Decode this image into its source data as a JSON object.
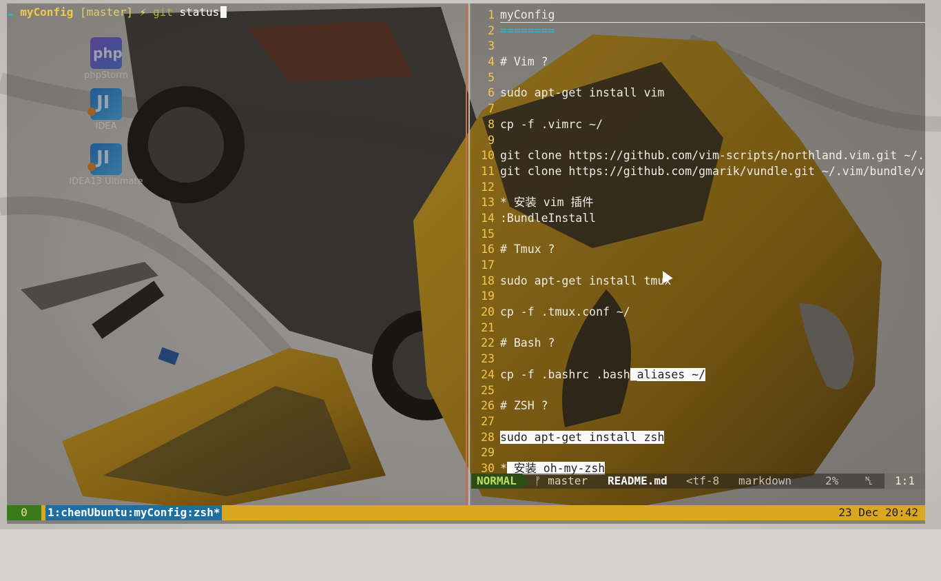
{
  "desktop": {
    "icons": [
      {
        "label": "phpStorm",
        "glyph": "php"
      },
      {
        "label": "IDEA",
        "glyph": "JI"
      },
      {
        "label": "IDEA13 Ultimate",
        "glyph": "JI"
      }
    ]
  },
  "shell": {
    "prompt_dir": "myConfig",
    "prompt_branch": "[master]",
    "prompt_bolt": "⚡",
    "prompt_git": "git",
    "prompt_cmd": "status"
  },
  "editor": {
    "lines": [
      {
        "n": "1",
        "text": "myConfig"
      },
      {
        "n": "2",
        "text": "========"
      },
      {
        "n": "3",
        "text": ""
      },
      {
        "n": "4",
        "text": "# Vim ?"
      },
      {
        "n": "5",
        "text": ""
      },
      {
        "n": "6",
        "text": "sudo apt-get install vim"
      },
      {
        "n": "7",
        "text": ""
      },
      {
        "n": "8",
        "text": "cp -f .vimrc ~/"
      },
      {
        "n": "9",
        "text": ""
      },
      {
        "n": "10",
        "text": "git clone https://github.com/vim-scripts/northland.vim.git ~/.v"
      },
      {
        "n": "11",
        "text": "git clone https://github.com/gmarik/vundle.git ~/.vim/bundle/vu"
      },
      {
        "n": "12",
        "text": ""
      },
      {
        "n": "13",
        "text": "* 安装 vim 插件"
      },
      {
        "n": "14",
        "text": ":BundleInstall"
      },
      {
        "n": "15",
        "text": ""
      },
      {
        "n": "16",
        "text": "# Tmux ?"
      },
      {
        "n": "17",
        "text": ""
      },
      {
        "n": "18",
        "text": "sudo apt-get install tmux"
      },
      {
        "n": "19",
        "text": ""
      },
      {
        "n": "20",
        "text": "cp -f .tmux.conf ~/"
      },
      {
        "n": "21",
        "text": ""
      },
      {
        "n": "22",
        "text": "# Bash ?"
      },
      {
        "n": "23",
        "text": ""
      },
      {
        "n": "24",
        "text": "cp -f .bashrc .bash",
        "hl": "_aliases ~/"
      },
      {
        "n": "25",
        "text": ""
      },
      {
        "n": "26",
        "text": "# ZSH ?"
      },
      {
        "n": "27",
        "text": ""
      },
      {
        "n": "28",
        "text": "",
        "hl": "sudo apt-get install zsh"
      },
      {
        "n": "29",
        "text": ""
      },
      {
        "n": "30",
        "text": "*",
        "hl": " 安装 oh-my-zsh"
      }
    ],
    "status": {
      "mode": "NORMAL",
      "branch": "ᚠ master",
      "file": "README.md",
      "encoding": "<tf-8",
      "filetype": "markdown",
      "percent": "2%",
      "line_icon": "␤",
      "position": "1:1"
    }
  },
  "tmux": {
    "session": "0",
    "window": "1:chenUbuntu:myConfig:zsh*",
    "clock": "23 Dec 20:42"
  }
}
